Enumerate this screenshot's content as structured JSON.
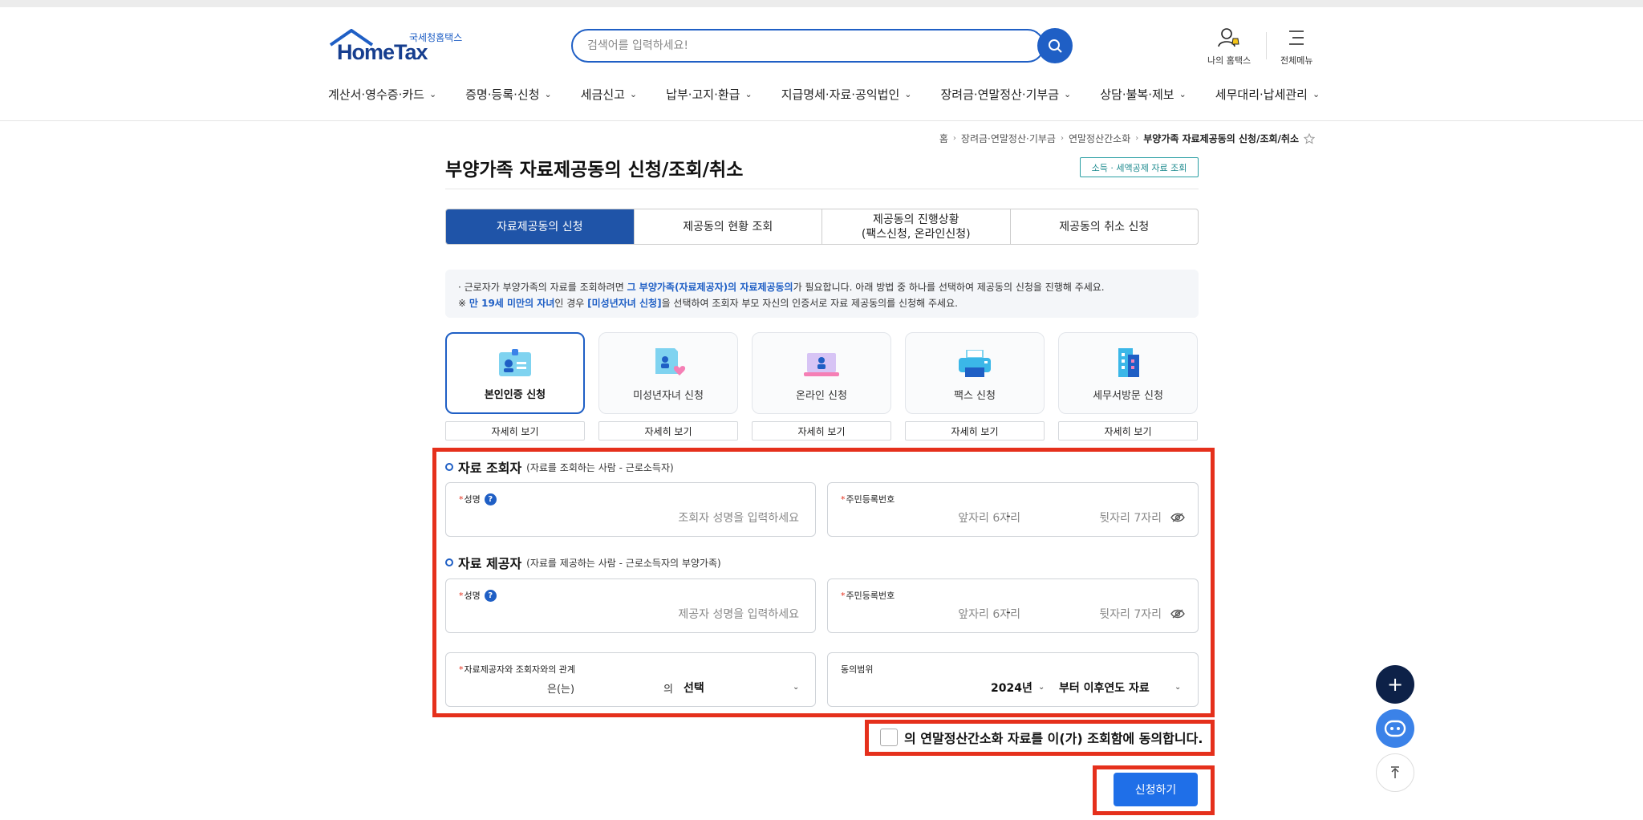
{
  "header": {
    "logo_sub": "국세청홈택스",
    "logo_main": "HomeTax",
    "search_placeholder": "검색어를 입력하세요!",
    "my_hometax": "나의 홈택스",
    "all_menu": "전체메뉴"
  },
  "gnb": [
    {
      "label": "계산서·영수증·카드"
    },
    {
      "label": "증명·등록·신청"
    },
    {
      "label": "세금신고"
    },
    {
      "label": "납부·고지·환급"
    },
    {
      "label": "지급명세·자료·공익법인"
    },
    {
      "label": "장려금·연말정산·기부금"
    },
    {
      "label": "상담·불복·제보"
    },
    {
      "label": "세무대리·납세관리"
    }
  ],
  "breadcrumb": {
    "home": "홈",
    "l1": "장려금·연말정산·기부금",
    "l2": "연말정산간소화",
    "current": "부양가족 자료제공동의 신청/조회/취소"
  },
  "page": {
    "title": "부양가족 자료제공동의 신청/조회/취소",
    "badge": "소득 · 세액공제 자료 조회"
  },
  "tabs": [
    {
      "label": "자료제공동의 신청",
      "active": true
    },
    {
      "label": "제공동의 현황 조회",
      "active": false
    },
    {
      "label": "제공동의 진행상황\n(팩스신청, 온라인신청)",
      "active": false
    },
    {
      "label": "제공동의 취소 신청",
      "active": false
    }
  ],
  "info": {
    "line1_a": "근로자가 부양가족의 자료를 조회하려면 ",
    "line1_hl": "그 부양가족(자료제공자)의 자료제공동의",
    "line1_b": "가 필요합니다. 아래 방법 중 하나를 선택하여 제공동의 신청을 진행해 주세요.",
    "line2_a": "※ ",
    "line2_hl1": "만 19세 미만의 자녀",
    "line2_b": "인 경우 ",
    "line2_hl2": "[미성년자녀 신청]",
    "line2_c": "을 선택하여 조회자 부모 자신의 인증서로 자료 제공동의를 신청해 주세요."
  },
  "methods": [
    {
      "label": "본인인증 신청",
      "icon": "id-card-icon",
      "active": true
    },
    {
      "label": "미성년자녀 신청",
      "icon": "child-doc-icon",
      "active": false
    },
    {
      "label": "온라인 신청",
      "icon": "laptop-icon",
      "active": false
    },
    {
      "label": "팩스 신청",
      "icon": "printer-icon",
      "active": false
    },
    {
      "label": "세무서방문 신청",
      "icon": "building-icon",
      "active": false
    }
  ],
  "detail_label": "자세히 보기",
  "viewer": {
    "title": "자료 조회자",
    "desc": "(자료를 조회하는 사람 - 근로소득자)",
    "name_label": "성명",
    "name_placeholder": "조회자 성명을 입력하세요",
    "rrn_label": "주민등록번호",
    "rrn_front_placeholder": "앞자리 6자리",
    "rrn_back_placeholder": "뒷자리 7자리"
  },
  "provider": {
    "title": "자료 제공자",
    "desc": "(자료를 제공하는 사람 - 근로소득자의 부양가족)",
    "name_label": "성명",
    "name_placeholder": "제공자 성명을 입력하세요",
    "rrn_label": "주민등록번호",
    "rrn_front_placeholder": "앞자리 6자리",
    "rrn_back_placeholder": "뒷자리 7자리"
  },
  "relation": {
    "label": "자료제공자와 조회자와의 관계",
    "eun": "은(는)",
    "ui": "의",
    "select": "선택"
  },
  "scope": {
    "label": "동의범위",
    "year": "2024년",
    "after": "부터 이후연도 자료"
  },
  "agree_text": "의 연말정산간소화 자료를 이(가) 조회함에 동의합니다.",
  "submit_label": "신청하기",
  "colors": {
    "primary": "#1f54a8",
    "accent": "#1f6fe8",
    "highlight_border": "#e5301c"
  }
}
